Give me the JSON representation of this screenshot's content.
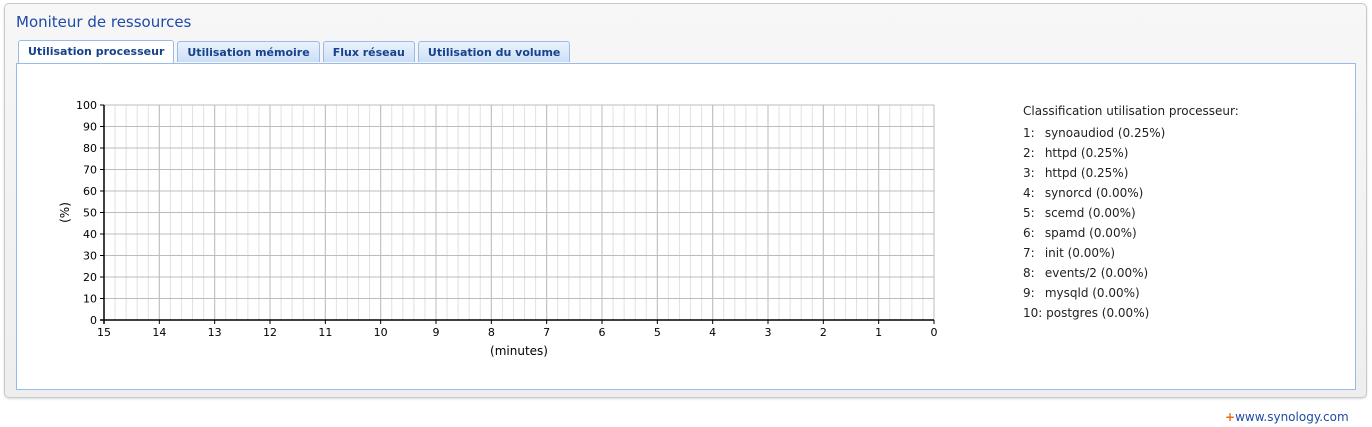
{
  "window": {
    "title": "Moniteur de ressources"
  },
  "tabs": [
    {
      "label": "Utilisation processeur",
      "active": true
    },
    {
      "label": "Utilisation mémoire",
      "active": false
    },
    {
      "label": "Flux réseau",
      "active": false
    },
    {
      "label": "Utilisation du volume",
      "active": false
    }
  ],
  "ranking": {
    "title": "Classification utilisation processeur:",
    "items": [
      {
        "num": "1:",
        "text": "synoaudiod (0.25%)"
      },
      {
        "num": "2:",
        "text": "httpd (0.25%)"
      },
      {
        "num": "3:",
        "text": "httpd (0.25%)"
      },
      {
        "num": "4:",
        "text": "synorcd (0.00%)"
      },
      {
        "num": "5:",
        "text": "scemd (0.00%)"
      },
      {
        "num": "6:",
        "text": "spamd (0.00%)"
      },
      {
        "num": "7:",
        "text": "init (0.00%)"
      },
      {
        "num": "8:",
        "text": "events/2 (0.00%)"
      },
      {
        "num": "9:",
        "text": "mysqld (0.00%)"
      },
      {
        "num": "10:",
        "text": "postgres (0.00%)"
      }
    ]
  },
  "chart_data": {
    "type": "line",
    "title": "",
    "xlabel": "(minutes)",
    "ylabel": "(%)",
    "x_ticks": [
      "15",
      "14",
      "13",
      "12",
      "11",
      "10",
      "9",
      "8",
      "7",
      "6",
      "5",
      "4",
      "3",
      "2",
      "1",
      "0"
    ],
    "y_ticks": [
      "0",
      "10",
      "20",
      "30",
      "40",
      "50",
      "60",
      "70",
      "80",
      "90",
      "100"
    ],
    "xlim": [
      15,
      0
    ],
    "ylim": [
      0,
      100
    ],
    "grid": true,
    "series": []
  },
  "footer": {
    "plus": "+",
    "link": "www.synology.com"
  }
}
